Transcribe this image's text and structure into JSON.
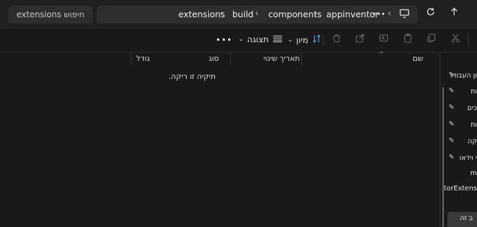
{
  "search": {
    "placeholder_text": "חיפוש extensions"
  },
  "breadcrumb": [
    "extensions",
    "build",
    "components",
    "appinventor"
  ],
  "toolbar": {
    "sort_label": "מיון",
    "view_label": "תצוגה",
    "more_label": "•••"
  },
  "columns": {
    "name": "שם",
    "modified": "תאריך שינוי",
    "type": "סוג",
    "size": "גודל"
  },
  "empty_message": "תיקיה זו ריקה.",
  "sidebar": {
    "items": [
      {
        "label": "ון העבודו",
        "pinned": true
      },
      {
        "label": "ות",
        "pinned": true
      },
      {
        "label": "כים",
        "pinned": true
      },
      {
        "label": "ות",
        "pinned": true
      },
      {
        "label": "קה",
        "pinned": true
      },
      {
        "label": "י וידאו",
        "pinned": true
      },
      {
        "label": "m",
        "pinned": false
      },
      {
        "label": "ventorExtens",
        "pinned": false
      }
    ],
    "bottom_label": "ב זה"
  },
  "icons": {
    "chevrons": "chevron-icon",
    "pin": "pin-icon"
  }
}
